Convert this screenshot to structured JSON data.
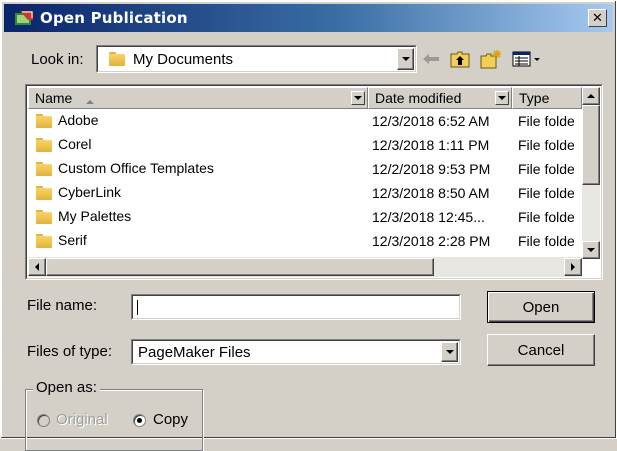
{
  "window": {
    "title": "Open Publication",
    "close_glyph": "✕"
  },
  "look_in": {
    "label": "Look in:",
    "value": "My Documents",
    "icon": "folder-icon"
  },
  "toolbar": {
    "icons": [
      "back-arrow-icon",
      "up-one-level-icon",
      "create-new-folder-icon",
      "view-menu-icon"
    ]
  },
  "file_list": {
    "columns": [
      "Name",
      "Date modified",
      "Type"
    ],
    "sort_column": "Name",
    "rows": [
      {
        "name": "Adobe",
        "date": "12/3/2018 6:52 AM",
        "type": "File folde"
      },
      {
        "name": "Corel",
        "date": "12/3/2018 1:11 PM",
        "type": "File folde"
      },
      {
        "name": "Custom Office Templates",
        "date": "12/2/2018 9:53 PM",
        "type": "File folde"
      },
      {
        "name": "CyberLink",
        "date": "12/3/2018 8:50 AM",
        "type": "File folde"
      },
      {
        "name": "My Palettes",
        "date": "12/3/2018 12:45...",
        "type": "File folde"
      },
      {
        "name": "Serif",
        "date": "12/3/2018 2:28 PM",
        "type": "File folde"
      }
    ]
  },
  "file_name": {
    "label": "File name:",
    "value": ""
  },
  "files_of_type": {
    "label": "Files of type:",
    "value": "PageMaker Files"
  },
  "buttons": {
    "open": "Open",
    "cancel": "Cancel"
  },
  "open_as": {
    "label": "Open as:",
    "options": [
      {
        "label": "Original",
        "selected": false,
        "enabled": false
      },
      {
        "label": "Copy",
        "selected": true,
        "enabled": true
      }
    ]
  }
}
